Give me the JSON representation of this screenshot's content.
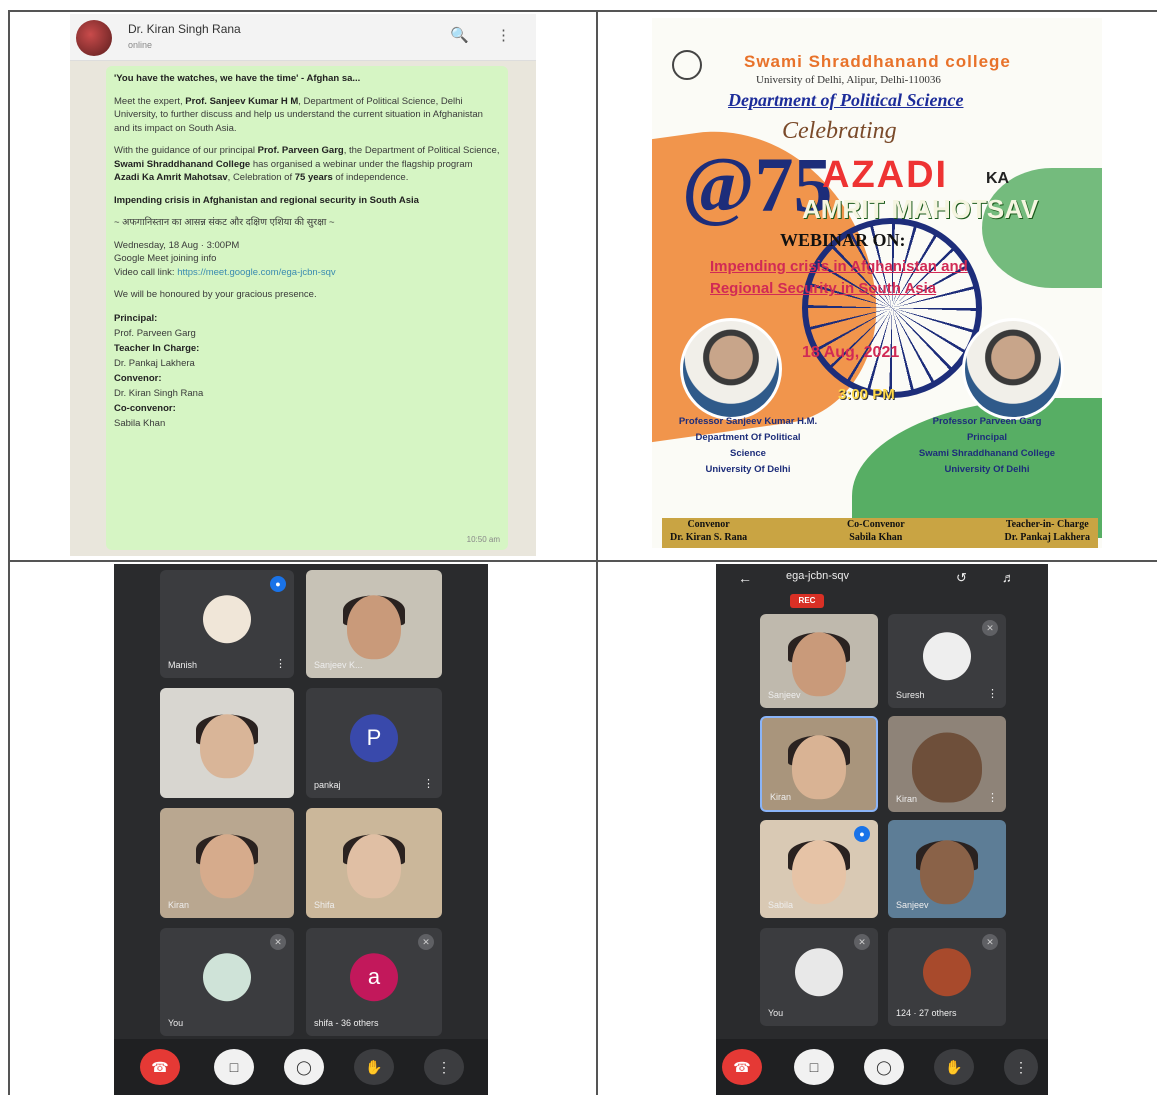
{
  "whatsapp": {
    "contact_name": "Dr. Kiran Singh Rana",
    "contact_status": "online",
    "quote_line": "'You have the watches, we have the time' - Afghan sa...",
    "para1_pre": "Meet the expert, ",
    "para1_bold": "Prof. Sanjeev Kumar H M",
    "para1_post": ", Department of Political Science, Delhi University, to further discuss and help us understand the current situation in Afghanistan and its impact on South Asia.",
    "para2_pre": "With the guidance of our principal ",
    "para2_bold1": "Prof. Parveen Garg",
    "para2_mid": ", the Department of Political Science, ",
    "para2_bold2": "Swami Shraddhanand College",
    "para2_mid2": " has organised a webinar under the flagship program ",
    "para2_bold3": "Azadi Ka Amrit Mahotsav",
    "para2_mid3": ", Celebration of ",
    "para2_bold4": "75 years",
    "para2_post": " of independence.",
    "topic": "Impending crisis in Afghanistan and regional security in South Asia",
    "hindi_line": "~ अफगानिस्तान का आसन्न संकट और दक्षिण एशिया की सुरक्षा ~",
    "date_line": "Wednesday, 18 Aug · 3:00PM",
    "meet_info": "Google Meet joining info",
    "video_label": "Video call link: ",
    "video_link": "https://meet.google.com/ega-jcbn-sqv",
    "honoured": "We will be honoured by your gracious presence.",
    "principal_label": "Principal:",
    "principal_name": "Prof. Parveen Garg",
    "tic_label": "Teacher In Charge:",
    "tic_name": "Dr. Pankaj Lakhera",
    "convenor_label": "Convenor:",
    "convenor_name": "Dr. Kiran Singh Rana",
    "coconvenor_label": "Co-convenor:",
    "coconvenor_name": "Sabila Khan",
    "time": "10:50 am",
    "icons": [
      "search-icon",
      "more-vert-icon"
    ]
  },
  "poster": {
    "college": "Swami Shraddhanand college",
    "university": "University of Delhi, Alipur, Delhi-110036",
    "department": "Department of Political Science",
    "celebrating": "Celebrating",
    "number": "@75",
    "azadi": "AZADI",
    "ka": "KA",
    "amrit": "AMRIT MAHOTSAV",
    "webinar": "WEBINAR ON:",
    "topic_line1": "Impending crisis in Afghanistan and",
    "topic_line2": "Regional Security in South Asia",
    "date": "18 Aug, 2021",
    "time": "3:00 PM",
    "speaker1": "Professor Sanjeev Kumar H.M.\nDepartment Of Political\nScience\nUniversity Of Delhi",
    "speaker2": "Professor Parveen Garg\nPrincipal\nSwami Shraddhanand College\nUniversity Of Delhi",
    "convenor": "Convenor\nDr. Kiran S. Rana",
    "coconvenor": "Co-Convenor\nSabila Khan",
    "tic": "Teacher-in- Charge\nDr. Pankaj Lakhera"
  },
  "meet_left": {
    "tiles": [
      {
        "name": "Manish",
        "type": "avatar"
      },
      {
        "name": "Sanjeev K...",
        "type": "video"
      },
      {
        "name": "",
        "type": "video"
      },
      {
        "name": "pankaj",
        "type": "letter",
        "letter": "P",
        "color": "#3949ab"
      },
      {
        "name": "Kiran",
        "type": "video"
      },
      {
        "name": "Shifa",
        "type": "video"
      },
      {
        "name": "You",
        "type": "avatar"
      },
      {
        "name": "shifa - 36 others",
        "type": "letter",
        "letter": "a",
        "color": "#c2185b"
      }
    ]
  },
  "meet_right": {
    "meeting_code": "ega-jcbn-sqv",
    "rec": "REC",
    "tiles": [
      {
        "name": "Sanjeev",
        "type": "video"
      },
      {
        "name": "Suresh",
        "type": "avatar"
      },
      {
        "name": "Kiran",
        "type": "video"
      },
      {
        "name": "Kiran",
        "type": "video"
      },
      {
        "name": "Sabila",
        "type": "video"
      },
      {
        "name": "Sanjeev",
        "type": "video"
      },
      {
        "name": "You",
        "type": "avatar"
      },
      {
        "name": "124 · 27 others",
        "type": "avatar"
      }
    ]
  }
}
